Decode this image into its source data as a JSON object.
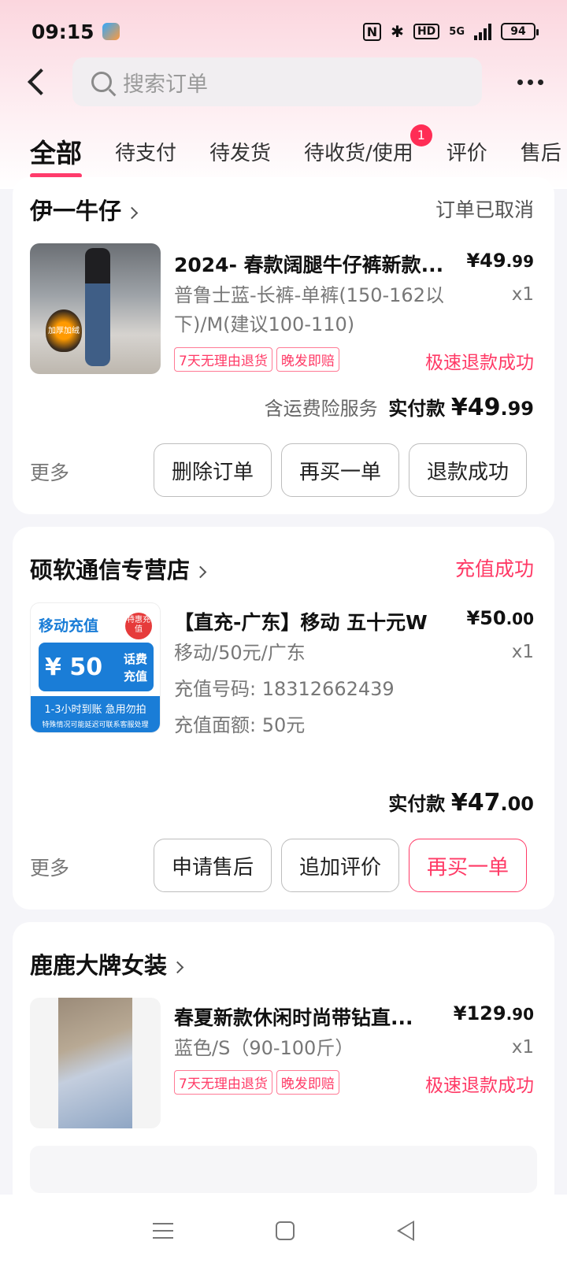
{
  "status_bar": {
    "time": "09:15",
    "network": "5G",
    "battery": "94"
  },
  "search": {
    "placeholder": "搜索订单"
  },
  "tabs": [
    {
      "label": "全部",
      "active": true
    },
    {
      "label": "待支付"
    },
    {
      "label": "待发货"
    },
    {
      "label": "待收货/使用",
      "badge": "1"
    },
    {
      "label": "评价"
    },
    {
      "label": "售后"
    }
  ],
  "orders": [
    {
      "shop": "伊一牛仔",
      "status": "订单已取消",
      "title": "2024- 春款阔腿牛仔裤新款...",
      "price_int": "¥49",
      "price_dec": ".99",
      "spec": "普鲁士蓝-长裤-单裤(150-162以下)/M(建议100-110)",
      "qty": "x1",
      "tags": [
        "7天无理由退货",
        "晚发即赔"
      ],
      "refund": "极速退款成功",
      "thumb_text": "加厚加绒",
      "insurance": "含运费险服务",
      "paid_label": "实付款",
      "paid_int": "¥49",
      "paid_dec": ".99",
      "more": "更多",
      "buttons": [
        "删除订单",
        "再买一单",
        "退款成功"
      ]
    },
    {
      "shop": "硕软通信专营店",
      "status": "充值成功",
      "title": "【直充-广东】移动 五十元W",
      "price_int": "¥50",
      "price_dec": ".00",
      "spec1": "移动/50元/广东",
      "spec2": "充值号码: 18312662439",
      "spec3": "充值面额: 50元",
      "qty": "x1",
      "thumb_title": "移动充值",
      "thumb_badge": "特惠充值",
      "thumb_amount": "¥ 50",
      "thumb_sub1": "话费",
      "thumb_sub2": "充值",
      "thumb_line1": "1-3小时到账  急用勿拍",
      "thumb_line2": "特殊情况可能延迟可联系客服处理",
      "paid_label": "实付款",
      "paid_int": "¥47",
      "paid_dec": ".00",
      "more": "更多",
      "buttons": [
        "申请售后",
        "追加评价",
        "再买一单"
      ]
    },
    {
      "shop": "鹿鹿大牌女装",
      "title": "春夏新款休闲时尚带钻直...",
      "price_int": "¥129",
      "price_dec": ".90",
      "spec": "蓝色/S（90-100斤）",
      "qty": "x1",
      "tags": [
        "7天无理由退货",
        "晚发即赔"
      ],
      "refund": "极速退款成功"
    }
  ]
}
